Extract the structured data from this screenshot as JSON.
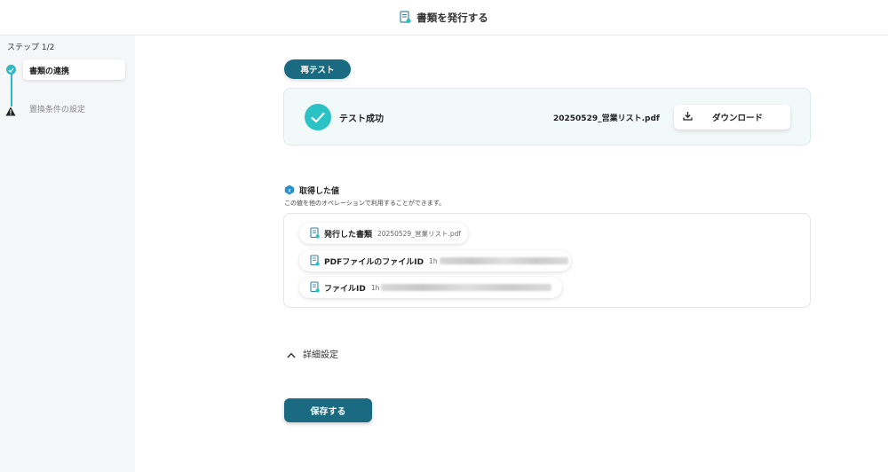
{
  "header": {
    "title": "書類を発行する",
    "icon": "document-icon"
  },
  "sidebar": {
    "step_count": "ステップ 1/2",
    "steps": [
      {
        "label": "書類の連携",
        "status": "complete"
      },
      {
        "label": "置換条件の設定",
        "status": "warning"
      }
    ]
  },
  "main": {
    "retest_label": "再テスト",
    "result": {
      "status_text": "テスト成功",
      "filename": "20250529_営業リスト.pdf",
      "download_label": "ダウンロード"
    },
    "values": {
      "heading": "取得した値",
      "description": "この値を他のオペレーションで利用することができます。",
      "items": [
        {
          "label": "発行した書類",
          "value": "20250529_営業リスト.pdf"
        },
        {
          "label": "PDFファイルのファイルID",
          "value": "1h"
        },
        {
          "label": "ファイルID",
          "value": "1h"
        }
      ]
    },
    "advanced_label": "詳細設定",
    "save_label": "保存する"
  },
  "colors": {
    "primary": "#1a6a82",
    "success": "#2bc2c5",
    "step_accent": "#2bb8c9",
    "result_bg": "#f2f9f9"
  }
}
